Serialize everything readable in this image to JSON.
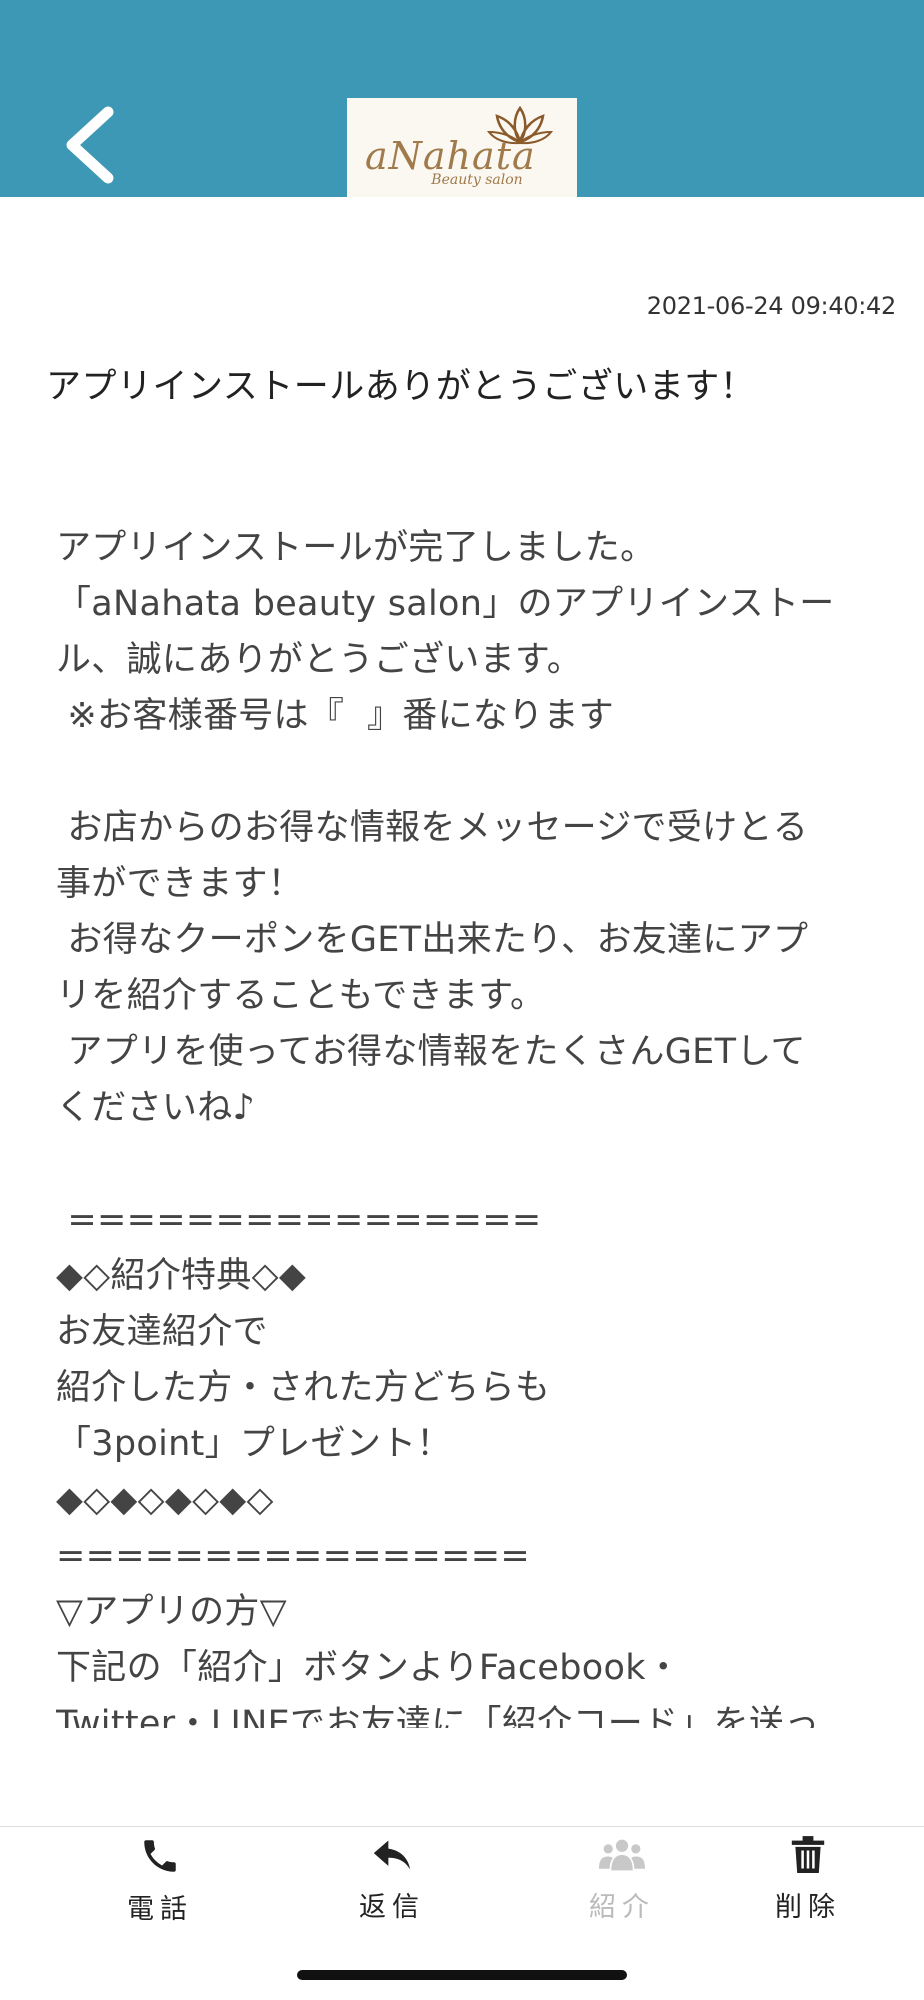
{
  "header": {
    "logo_text": "aNahata",
    "logo_subtext": "Beauty salon",
    "accent_color": "#3c98b5"
  },
  "message": {
    "timestamp": "2021-06-24 09:40:42",
    "title": "アプリインストールありがとうございます！",
    "body_lines": [
      "アプリインストールが完了しました。",
      "「aNahata beauty salon」のアプリインストー",
      "ル、誠にありがとうございます。",
      " ※お客様番号は『  』番になります",
      "",
      " お店からのお得な情報をメッセージで受けとる",
      "事ができます！",
      " お得なクーポンをGET出来たり、お友達にアプ",
      "リを紹介することもできます。",
      " アプリを使ってお得な情報をたくさんGETして",
      "くださいね♪",
      "",
      " ================",
      "◆◇紹介特典◇◆",
      "お友達紹介で",
      "紹介した方・された方どちらも",
      "「3point」プレゼント！",
      "◆◇◆◇◆◇◆◇",
      "================",
      "▽アプリの方▽",
      "下記の「紹介」ボタンよりFacebook・",
      "Twitter・LINEでお友達に「紹介コード」を送っ"
    ]
  },
  "tabbar": {
    "call_label": "電話",
    "reply_label": "返信",
    "refer_label": "紹介",
    "delete_label": "削除"
  }
}
